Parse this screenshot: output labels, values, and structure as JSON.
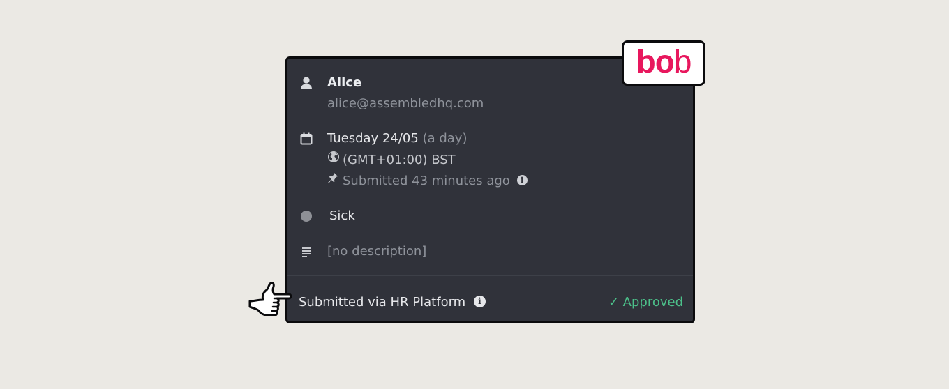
{
  "user": {
    "name": "Alice",
    "email": "alice@assembledhq.com"
  },
  "event": {
    "date": "Tuesday 24/05",
    "duration": "(a day)",
    "timezone_offset": "(GMT+01:00)",
    "timezone_name": "BST",
    "submitted": "Submitted 43 minutes ago"
  },
  "type": {
    "label": "Sick",
    "color": "#8e9096"
  },
  "description": "[no description]",
  "footer": {
    "source": "Submitted via HR Platform",
    "status": "Approved",
    "status_mark": "✓",
    "status_color": "#4cc08a"
  },
  "logo": {
    "text_part1": "b",
    "text_part2": "o",
    "text_part3": "b",
    "color": "#e8175d"
  },
  "icons": {
    "person": "person-icon",
    "calendar": "calendar-icon",
    "globe": "globe-icon",
    "pushpin": "pushpin-icon",
    "info": "info-icon",
    "description": "description-lines-icon",
    "status_dot": "status-dot-icon",
    "pointing_hand": "pointing-hand-icon"
  }
}
